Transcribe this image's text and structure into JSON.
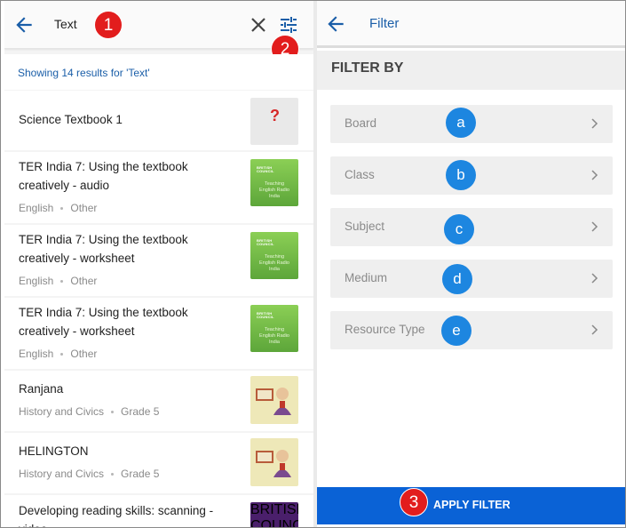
{
  "search": {
    "query": "Text",
    "results_summary": "Showing 14 results for 'Text'"
  },
  "results": [
    {
      "title": "Science Textbook 1",
      "language": "",
      "category": "",
      "thumb": "science-question-mark"
    },
    {
      "title": "TER India 7: Using the textbook creatively - audio",
      "language": "English",
      "category": "Other",
      "thumb": "teaching-english-radio-india"
    },
    {
      "title": "TER India 7: Using the textbook creatively - worksheet",
      "language": "English",
      "category": "Other",
      "thumb": "teaching-english-radio-india"
    },
    {
      "title": "TER India 7: Using the textbook creatively - worksheet",
      "language": "English",
      "category": "Other",
      "thumb": "teaching-english-radio-india"
    },
    {
      "title": "Ranjana",
      "language": "History and Civics",
      "category": "Grade 5",
      "thumb": "history-cartoon"
    },
    {
      "title": "HELINGTON",
      "language": "History and Civics",
      "category": "Grade 5",
      "thumb": "history-cartoon"
    },
    {
      "title": "Developing reading skills: scanning - video",
      "language": "",
      "category": "",
      "thumb": "british-council-purple"
    }
  ],
  "thumb_text": {
    "bc_logo": "BRITISH\nCOUNCIL",
    "ter_caption": "Teaching\nEnglish Radio\nIndia"
  },
  "filter": {
    "title": "Filter",
    "heading": "FILTER BY",
    "options": [
      "Board",
      "Class",
      "Subject",
      "Medium",
      "Resource Type"
    ],
    "option_markers": [
      "a",
      "b",
      "c",
      "d",
      "e"
    ],
    "apply_label": "APPLY FILTER"
  },
  "step_markers": [
    "1",
    "2",
    "3"
  ],
  "colors": {
    "accent_blue": "#1a5ea8",
    "apply_button": "#0a62d6",
    "marker_red": "#e21d1d",
    "marker_blue": "#1d86e0"
  },
  "icons": [
    "back-arrow-icon",
    "close-icon",
    "filter-sliders-icon",
    "chevron-right-icon"
  ]
}
